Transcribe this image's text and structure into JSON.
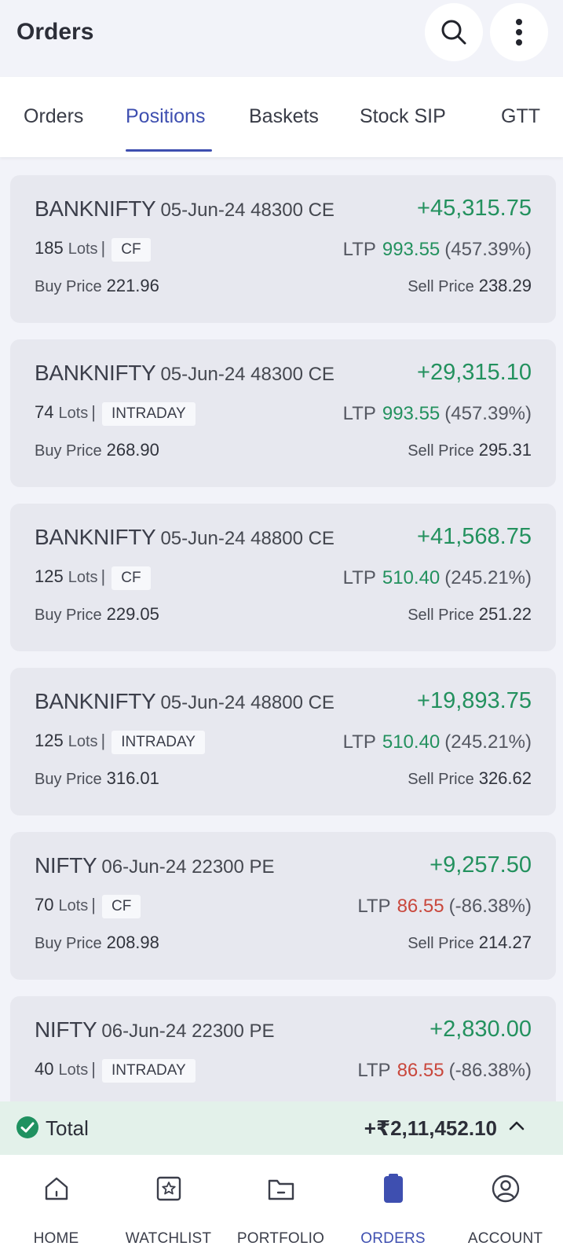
{
  "header": {
    "title": "Orders"
  },
  "tabs": [
    {
      "label": "Orders"
    },
    {
      "label": "Positions",
      "active": true
    },
    {
      "label": "Baskets"
    },
    {
      "label": "Stock SIP"
    },
    {
      "label": "GTT"
    }
  ],
  "positions": [
    {
      "symbol": "BANKNIFTY",
      "contract": "05-Jun-24 48300 CE",
      "pnl": "+45,315.75",
      "lots": "185",
      "lots_label": "Lots",
      "product": "CF",
      "ltp_label": "LTP",
      "ltp": "993.55",
      "ltp_change": "(457.39%)",
      "buy_label": "Buy Price",
      "buy_price": "221.96",
      "sell_label": "Sell Price",
      "sell_price": "238.29"
    },
    {
      "symbol": "BANKNIFTY",
      "contract": "05-Jun-24 48300 CE",
      "pnl": "+29,315.10",
      "lots": "74",
      "lots_label": "Lots",
      "product": "INTRADAY",
      "ltp_label": "LTP",
      "ltp": "993.55",
      "ltp_change": "(457.39%)",
      "buy_label": "Buy Price",
      "buy_price": "268.90",
      "sell_label": "Sell Price",
      "sell_price": "295.31"
    },
    {
      "symbol": "BANKNIFTY",
      "contract": "05-Jun-24 48800 CE",
      "pnl": "+41,568.75",
      "lots": "125",
      "lots_label": "Lots",
      "product": "CF",
      "ltp_label": "LTP",
      "ltp": "510.40",
      "ltp_change": "(245.21%)",
      "buy_label": "Buy Price",
      "buy_price": "229.05",
      "sell_label": "Sell Price",
      "sell_price": "251.22"
    },
    {
      "symbol": "BANKNIFTY",
      "contract": "05-Jun-24 48800 CE",
      "pnl": "+19,893.75",
      "lots": "125",
      "lots_label": "Lots",
      "product": "INTRADAY",
      "ltp_label": "LTP",
      "ltp": "510.40",
      "ltp_change": "(245.21%)",
      "buy_label": "Buy Price",
      "buy_price": "316.01",
      "sell_label": "Sell Price",
      "sell_price": "326.62"
    },
    {
      "symbol": "NIFTY",
      "contract": "06-Jun-24 22300 PE",
      "pnl": "+9,257.50",
      "lots": "70",
      "lots_label": "Lots",
      "product": "CF",
      "ltp_label": "LTP",
      "ltp": "86.55",
      "ltp_change": "(-86.38%)",
      "buy_label": "Buy Price",
      "buy_price": "208.98",
      "sell_label": "Sell Price",
      "sell_price": "214.27"
    },
    {
      "symbol": "NIFTY",
      "contract": "06-Jun-24 22300 PE",
      "pnl": "+2,830.00",
      "lots": "40",
      "lots_label": "Lots",
      "product": "INTRADAY",
      "ltp_label": "LTP",
      "ltp": "86.55",
      "ltp_change": "(-86.38%)",
      "buy_label": "",
      "buy_price": "",
      "sell_label": "",
      "sell_price": ""
    }
  ],
  "total": {
    "label": "Total",
    "value": "+₹2,11,452.10"
  },
  "bottom_nav": [
    {
      "label": "HOME",
      "icon": "home-icon"
    },
    {
      "label": "WATCHLIST",
      "icon": "watchlist-icon"
    },
    {
      "label": "PORTFOLIO",
      "icon": "portfolio-icon"
    },
    {
      "label": "ORDERS",
      "icon": "orders-icon",
      "active": true
    },
    {
      "label": "ACCOUNT",
      "icon": "account-icon"
    }
  ],
  "colors": {
    "accent": "#3e4fb0",
    "profit": "#23915e",
    "loss": "#c9473c",
    "total_bg": "#e3f1ea"
  }
}
